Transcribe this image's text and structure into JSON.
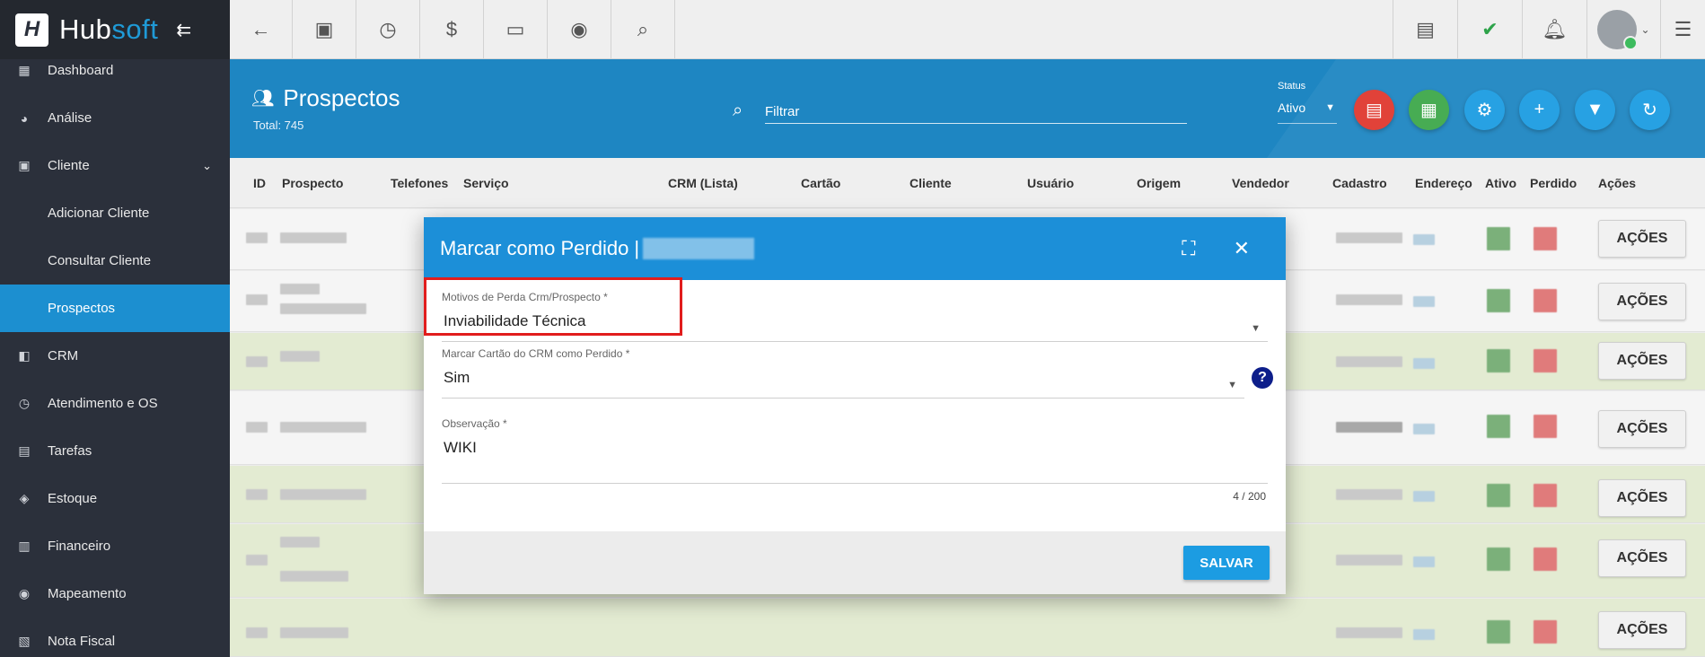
{
  "brand": {
    "name_part1": "Hub",
    "name_part2": "soft",
    "collapse_icon": "collapse-icon"
  },
  "sidebar": {
    "items": [
      {
        "label": "Dashboard",
        "icon": "dashboard-icon"
      },
      {
        "label": "Análise",
        "icon": "pie-chart-icon"
      },
      {
        "label": "Cliente",
        "icon": "client-icon"
      },
      {
        "label": "Adicionar Cliente"
      },
      {
        "label": "Consultar Cliente"
      },
      {
        "label": "Prospectos"
      },
      {
        "label": "CRM",
        "icon": "crm-icon"
      },
      {
        "label": "Atendimento e OS",
        "icon": "calendar-clock-icon"
      },
      {
        "label": "Tarefas",
        "icon": "tasks-icon"
      },
      {
        "label": "Estoque",
        "icon": "box-icon"
      },
      {
        "label": "Financeiro",
        "icon": "money-icon"
      },
      {
        "label": "Mapeamento",
        "icon": "map-pin-icon"
      },
      {
        "label": "Nota Fiscal",
        "icon": "receipt-icon"
      }
    ]
  },
  "page": {
    "title": "Prospectos",
    "total": "Total: 745"
  },
  "filter": {
    "placeholder": "Filtrar"
  },
  "status": {
    "label": "Status",
    "value": "Ativo"
  },
  "colors": {
    "accent": "#1c8fd8",
    "pdf": "#e0382f",
    "excel": "#3ea84a",
    "sidebar_bg": "#2b303b",
    "active": "#1c8fd0",
    "highlight": "#e11d1d"
  },
  "table": {
    "headers": [
      "ID",
      "Prospecto",
      "Telefones",
      "Serviço",
      "CRM (Lista)",
      "Cartão",
      "Cliente",
      "Usuário",
      "Origem",
      "Vendedor",
      "Cadastro",
      "Endereço",
      "Ativo",
      "Perdido",
      "Ações"
    ],
    "action_label": "AÇÕES"
  },
  "modal": {
    "title": "Marcar como Perdido |",
    "field1": {
      "label": "Motivos de Perda Crm/Prospecto *",
      "value": "Inviabilidade Técnica"
    },
    "field2": {
      "label": "Marcar Cartão do CRM como Perdido *",
      "value": "Sim"
    },
    "field3": {
      "label": "Observação *",
      "value": "WIKI"
    },
    "counter": "4 / 200",
    "save_label": "SALVAR"
  }
}
